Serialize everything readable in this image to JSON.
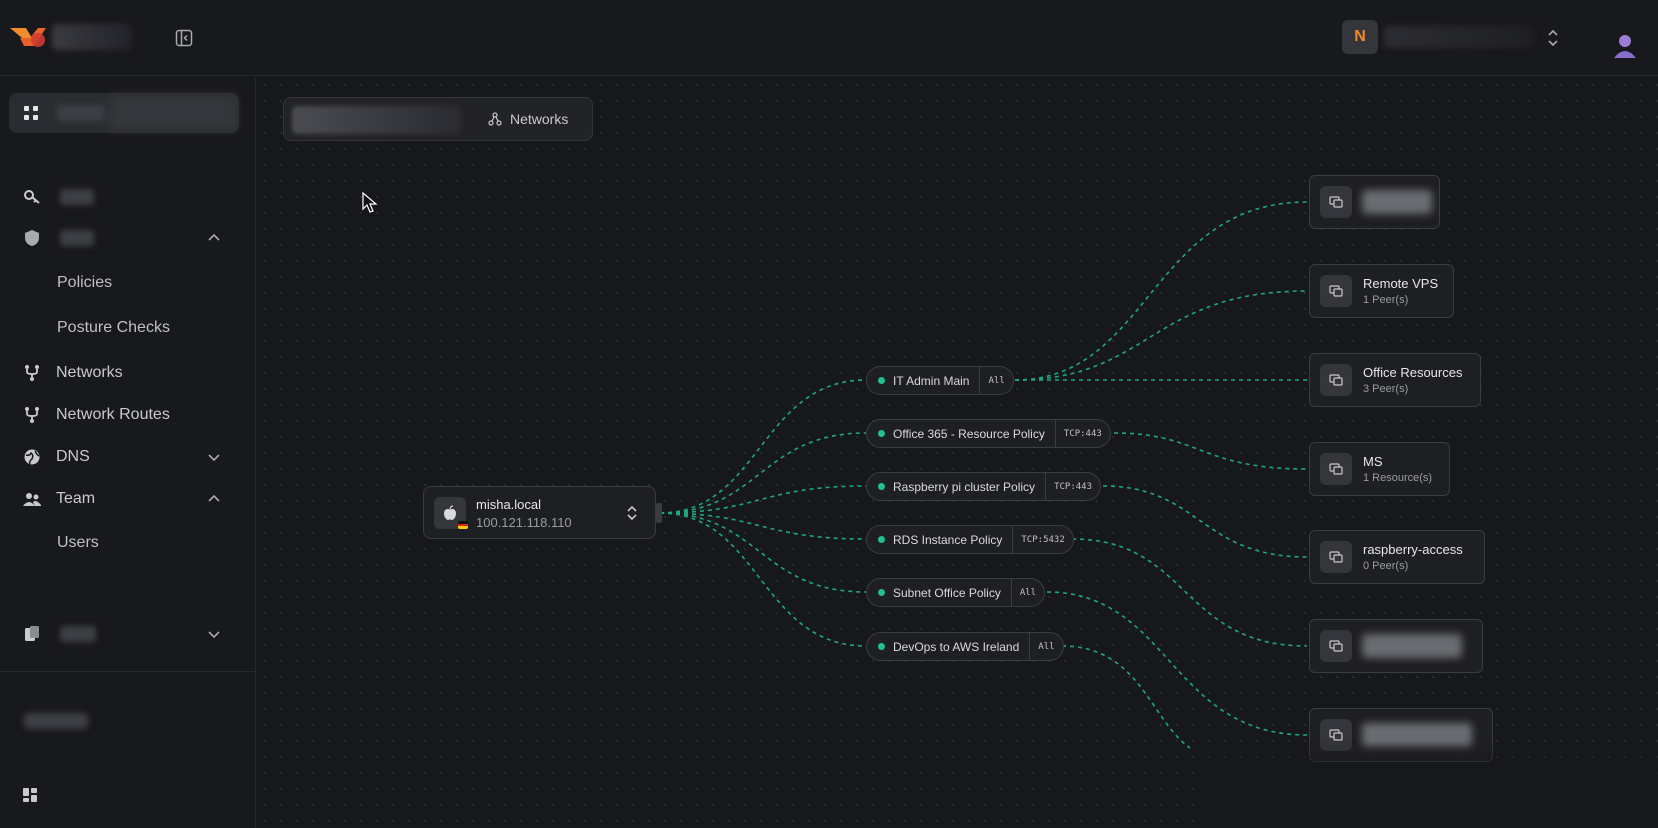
{
  "topbar": {
    "workspace_initial": "N"
  },
  "sidebar": {
    "items": [
      {
        "label": "Policies"
      },
      {
        "label": "Posture Checks"
      },
      {
        "label": "Networks"
      },
      {
        "label": "Network Routes"
      },
      {
        "label": "DNS"
      },
      {
        "label": "Team"
      },
      {
        "label": "Users"
      }
    ]
  },
  "canvas": {
    "view_toggle_label": "Networks",
    "peer": {
      "name": "misha.local",
      "ip": "100.121.118.110"
    },
    "policies": [
      {
        "name": "IT Admin Main",
        "proto": "All"
      },
      {
        "name": "Office 365 - Resource Policy",
        "proto": "TCP:443"
      },
      {
        "name": "Raspberry pi cluster Policy",
        "proto": "TCP:443"
      },
      {
        "name": "RDS Instance Policy",
        "proto": "TCP:5432"
      },
      {
        "name": "Subnet Office Policy",
        "proto": "All"
      },
      {
        "name": "DevOps to AWS Ireland",
        "proto": "All"
      }
    ],
    "resources": [
      {
        "name": "Remote VPS",
        "sub": "1 Peer(s)"
      },
      {
        "name": "Office Resources",
        "sub": "3 Peer(s)"
      },
      {
        "name": "MS",
        "sub": "1 Resource(s)"
      },
      {
        "name": "raspberry-access",
        "sub": "0 Peer(s)"
      }
    ]
  },
  "colors": {
    "accent_green": "#22c08a",
    "workspace_initial": "#f08a2c",
    "background": "#17181b"
  }
}
